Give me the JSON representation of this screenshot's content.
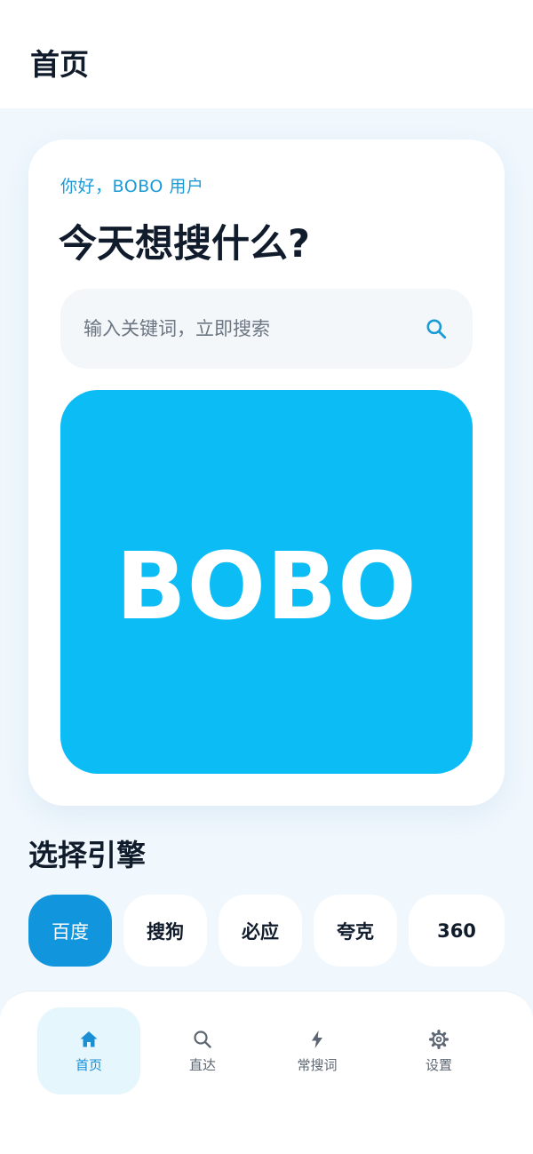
{
  "header": {
    "title": "首页"
  },
  "hero": {
    "greeting": "你好，BOBO 用户",
    "headline": "今天想搜什么?",
    "search": {
      "placeholder": "输入关键词，立即搜索",
      "value": ""
    },
    "banner_logo": "BOBO"
  },
  "engines": {
    "title": "选择引擎",
    "items": [
      {
        "label": "百度",
        "active": true
      },
      {
        "label": "搜狗",
        "active": false
      },
      {
        "label": "必应",
        "active": false
      },
      {
        "label": "夸克",
        "active": false
      },
      {
        "label": "360",
        "active": false
      }
    ]
  },
  "bottom_nav": {
    "items": [
      {
        "label": "首页",
        "icon": "home-icon",
        "active": true
      },
      {
        "label": "直达",
        "icon": "search-icon",
        "active": false
      },
      {
        "label": "常搜词",
        "icon": "lightning-icon",
        "active": false
      },
      {
        "label": "设置",
        "icon": "gear-icon",
        "active": false
      }
    ]
  },
  "colors": {
    "accent": "#1195dd",
    "banner": "#0cbcf5",
    "text_dark": "#101b2b",
    "page_bg": "#f1f8fd"
  }
}
